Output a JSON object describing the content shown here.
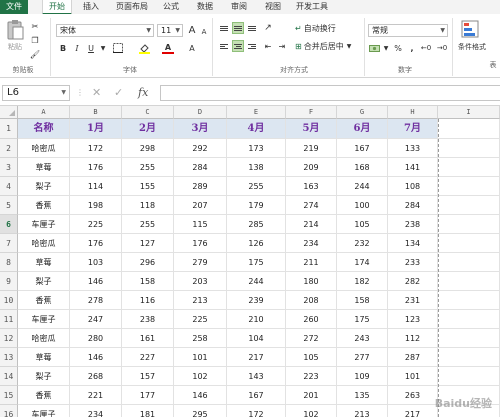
{
  "ribbon_tabs": [
    "文件",
    "开始",
    "插入",
    "页面布局",
    "公式",
    "数据",
    "审阅",
    "视图",
    "开发工具"
  ],
  "active_tab": "开始",
  "clipboard": {
    "paste_label": "粘贴",
    "group_label": "剪贴板"
  },
  "font": {
    "name": "宋体",
    "size": "11",
    "group_label": "字体",
    "grow_label": "A",
    "shrink_label": "A",
    "bold": "B",
    "italic": "I",
    "underline": "U",
    "font_color_label": "A",
    "highlight_label": "A"
  },
  "alignment": {
    "wrap_label": "自动换行",
    "merge_label": "合并后居中",
    "group_label": "对齐方式"
  },
  "number": {
    "format": "常规",
    "percent": "%",
    "comma": ",",
    "group_label": "数字"
  },
  "styles": {
    "conditional_label": "条件格式",
    "table_label": "表"
  },
  "formula_bar": {
    "cell_ref": "L6",
    "fx_label": "fx",
    "cancel_label": "✕",
    "confirm_label": "✓",
    "content": ""
  },
  "columns": [
    "A",
    "B",
    "C",
    "D",
    "E",
    "F",
    "G",
    "H",
    "I"
  ],
  "row_numbers": [
    "1",
    "2",
    "3",
    "4",
    "5",
    "6",
    "7",
    "8",
    "9",
    "10",
    "11",
    "12",
    "13",
    "14",
    "15",
    "16"
  ],
  "selected_row": "6",
  "table": {
    "headers": [
      "名称",
      "1月",
      "2月",
      "3月",
      "4月",
      "5月",
      "6月",
      "7月"
    ],
    "rows": [
      [
        "哈密瓜",
        "172",
        "298",
        "292",
        "173",
        "219",
        "167",
        "133"
      ],
      [
        "草莓",
        "176",
        "255",
        "284",
        "138",
        "209",
        "168",
        "141"
      ],
      [
        "梨子",
        "114",
        "155",
        "289",
        "255",
        "163",
        "244",
        "108"
      ],
      [
        "香蕉",
        "198",
        "118",
        "207",
        "179",
        "274",
        "100",
        "284"
      ],
      [
        "车厘子",
        "225",
        "255",
        "115",
        "285",
        "214",
        "105",
        "238"
      ],
      [
        "哈密瓜",
        "176",
        "127",
        "176",
        "126",
        "234",
        "232",
        "134"
      ],
      [
        "草莓",
        "103",
        "296",
        "279",
        "175",
        "211",
        "174",
        "233"
      ],
      [
        "梨子",
        "146",
        "158",
        "203",
        "244",
        "180",
        "182",
        "282"
      ],
      [
        "香蕉",
        "278",
        "116",
        "213",
        "239",
        "208",
        "158",
        "231"
      ],
      [
        "车厘子",
        "247",
        "238",
        "225",
        "210",
        "260",
        "175",
        "123"
      ],
      [
        "哈密瓜",
        "280",
        "161",
        "258",
        "104",
        "272",
        "243",
        "112"
      ],
      [
        "草莓",
        "146",
        "227",
        "101",
        "217",
        "105",
        "277",
        "287"
      ],
      [
        "梨子",
        "268",
        "157",
        "102",
        "143",
        "223",
        "109",
        "101"
      ],
      [
        "香蕉",
        "221",
        "177",
        "146",
        "167",
        "201",
        "135",
        "263"
      ],
      [
        "车厘子",
        "234",
        "181",
        "295",
        "172",
        "102",
        "213",
        "217"
      ]
    ]
  },
  "colors": {
    "header_fill": "#dce6f1",
    "header_text": "#7030a0",
    "accent": "#217346"
  },
  "watermark": "Baidu经验"
}
